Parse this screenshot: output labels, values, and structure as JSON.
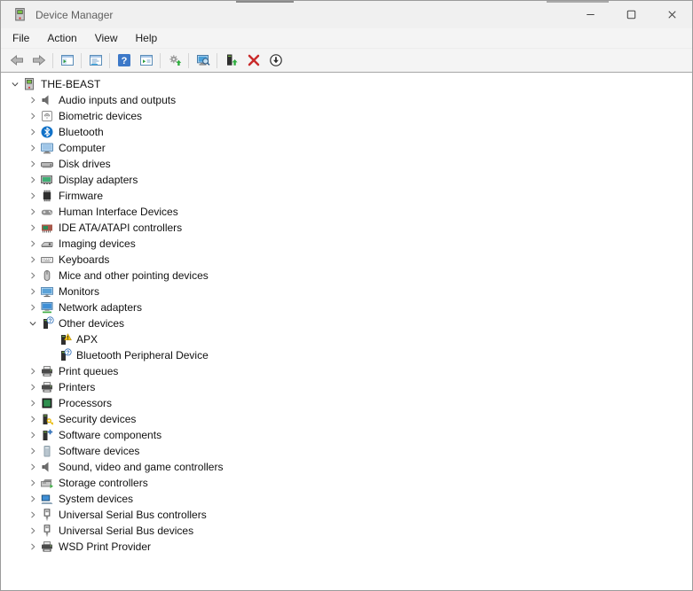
{
  "window": {
    "title": "Device Manager",
    "app_icon": "device-manager-icon",
    "caption_buttons": [
      {
        "name": "minimize",
        "icon": "minimize-icon"
      },
      {
        "name": "maximize",
        "icon": "maximize-icon"
      },
      {
        "name": "close",
        "icon": "close-icon"
      }
    ]
  },
  "menu_bar": {
    "items": [
      {
        "label": "File"
      },
      {
        "label": "Action"
      },
      {
        "label": "View"
      },
      {
        "label": "Help"
      }
    ]
  },
  "toolbar": {
    "groups": [
      [
        {
          "name": "back",
          "icon": "back-icon"
        },
        {
          "name": "forward",
          "icon": "forward-icon"
        }
      ],
      [
        {
          "name": "show-console-tree",
          "icon": "console-tree-icon"
        }
      ],
      [
        {
          "name": "properties",
          "icon": "properties-icon"
        }
      ],
      [
        {
          "name": "help",
          "icon": "help-icon"
        },
        {
          "name": "show-action-pane",
          "icon": "action-pane-icon"
        }
      ],
      [
        {
          "name": "update-driver",
          "icon": "update-driver-icon"
        }
      ],
      [
        {
          "name": "scan-for-hardware-changes",
          "icon": "scan-hardware-icon"
        }
      ],
      [
        {
          "name": "add-drivers",
          "icon": "add-driver-icon"
        },
        {
          "name": "uninstall-device",
          "icon": "uninstall-icon"
        },
        {
          "name": "disable-device",
          "icon": "disable-icon"
        }
      ]
    ]
  },
  "tree": {
    "items": [
      {
        "label": "THE-BEAST",
        "icon": "computer-icon",
        "level": 0,
        "state": "expanded"
      },
      {
        "label": "Audio inputs and outputs",
        "icon": "speaker-icon",
        "level": 1,
        "state": "collapsed"
      },
      {
        "label": "Biometric devices",
        "icon": "fingerprint-icon",
        "level": 1,
        "state": "collapsed"
      },
      {
        "label": "Bluetooth",
        "icon": "bluetooth-icon",
        "level": 1,
        "state": "collapsed"
      },
      {
        "label": "Computer",
        "icon": "monitor-icon",
        "level": 1,
        "state": "collapsed"
      },
      {
        "label": "Disk drives",
        "icon": "disk-drive-icon",
        "level": 1,
        "state": "collapsed"
      },
      {
        "label": "Display adapters",
        "icon": "display-adapter-icon",
        "level": 1,
        "state": "collapsed"
      },
      {
        "label": "Firmware",
        "icon": "firmware-chip-icon",
        "level": 1,
        "state": "collapsed"
      },
      {
        "label": "Human Interface Devices",
        "icon": "gamepad-icon",
        "level": 1,
        "state": "collapsed"
      },
      {
        "label": "IDE ATA/ATAPI controllers",
        "icon": "ide-controller-icon",
        "level": 1,
        "state": "collapsed"
      },
      {
        "label": "Imaging devices",
        "icon": "imaging-device-icon",
        "level": 1,
        "state": "collapsed"
      },
      {
        "label": "Keyboards",
        "icon": "keyboard-icon",
        "level": 1,
        "state": "collapsed"
      },
      {
        "label": "Mice and other pointing devices",
        "icon": "mouse-icon",
        "level": 1,
        "state": "collapsed"
      },
      {
        "label": "Monitors",
        "icon": "monitors-icon",
        "level": 1,
        "state": "collapsed"
      },
      {
        "label": "Network adapters",
        "icon": "network-adapter-icon",
        "level": 1,
        "state": "collapsed"
      },
      {
        "label": "Other devices",
        "icon": "unknown-device-icon",
        "level": 1,
        "state": "expanded"
      },
      {
        "label": "APX",
        "icon": "warning-device-icon",
        "level": 2,
        "state": "leaf"
      },
      {
        "label": "Bluetooth Peripheral Device",
        "icon": "unknown-device-icon",
        "level": 2,
        "state": "leaf"
      },
      {
        "label": "Print queues",
        "icon": "printer-icon",
        "level": 1,
        "state": "collapsed"
      },
      {
        "label": "Printers",
        "icon": "printer-icon",
        "level": 1,
        "state": "collapsed"
      },
      {
        "label": "Processors",
        "icon": "processor-icon",
        "level": 1,
        "state": "collapsed"
      },
      {
        "label": "Security devices",
        "icon": "security-device-icon",
        "level": 1,
        "state": "collapsed"
      },
      {
        "label": "Software components",
        "icon": "software-component-icon",
        "level": 1,
        "state": "collapsed"
      },
      {
        "label": "Software devices",
        "icon": "software-device-icon",
        "level": 1,
        "state": "collapsed"
      },
      {
        "label": "Sound, video and game controllers",
        "icon": "speaker-icon",
        "level": 1,
        "state": "collapsed"
      },
      {
        "label": "Storage controllers",
        "icon": "storage-controller-icon",
        "level": 1,
        "state": "collapsed"
      },
      {
        "label": "System devices",
        "icon": "system-device-icon",
        "level": 1,
        "state": "collapsed"
      },
      {
        "label": "Universal Serial Bus controllers",
        "icon": "usb-icon",
        "level": 1,
        "state": "collapsed"
      },
      {
        "label": "Universal Serial Bus devices",
        "icon": "usb-icon",
        "level": 1,
        "state": "collapsed"
      },
      {
        "label": "WSD Print Provider",
        "icon": "printer-icon",
        "level": 1,
        "state": "collapsed"
      }
    ]
  },
  "colors": {
    "titlebar_bg": "#f0f0f0",
    "chrome_bg": "#f4f4f4",
    "content_bg": "#ffffff",
    "window_border": "#9b9b9b",
    "accent_blue": "#1272c8",
    "warning_yellow": "#f5c518",
    "error_red": "#c92a2a",
    "title_text": "#5f5f5f",
    "tree_text": "#111111"
  }
}
